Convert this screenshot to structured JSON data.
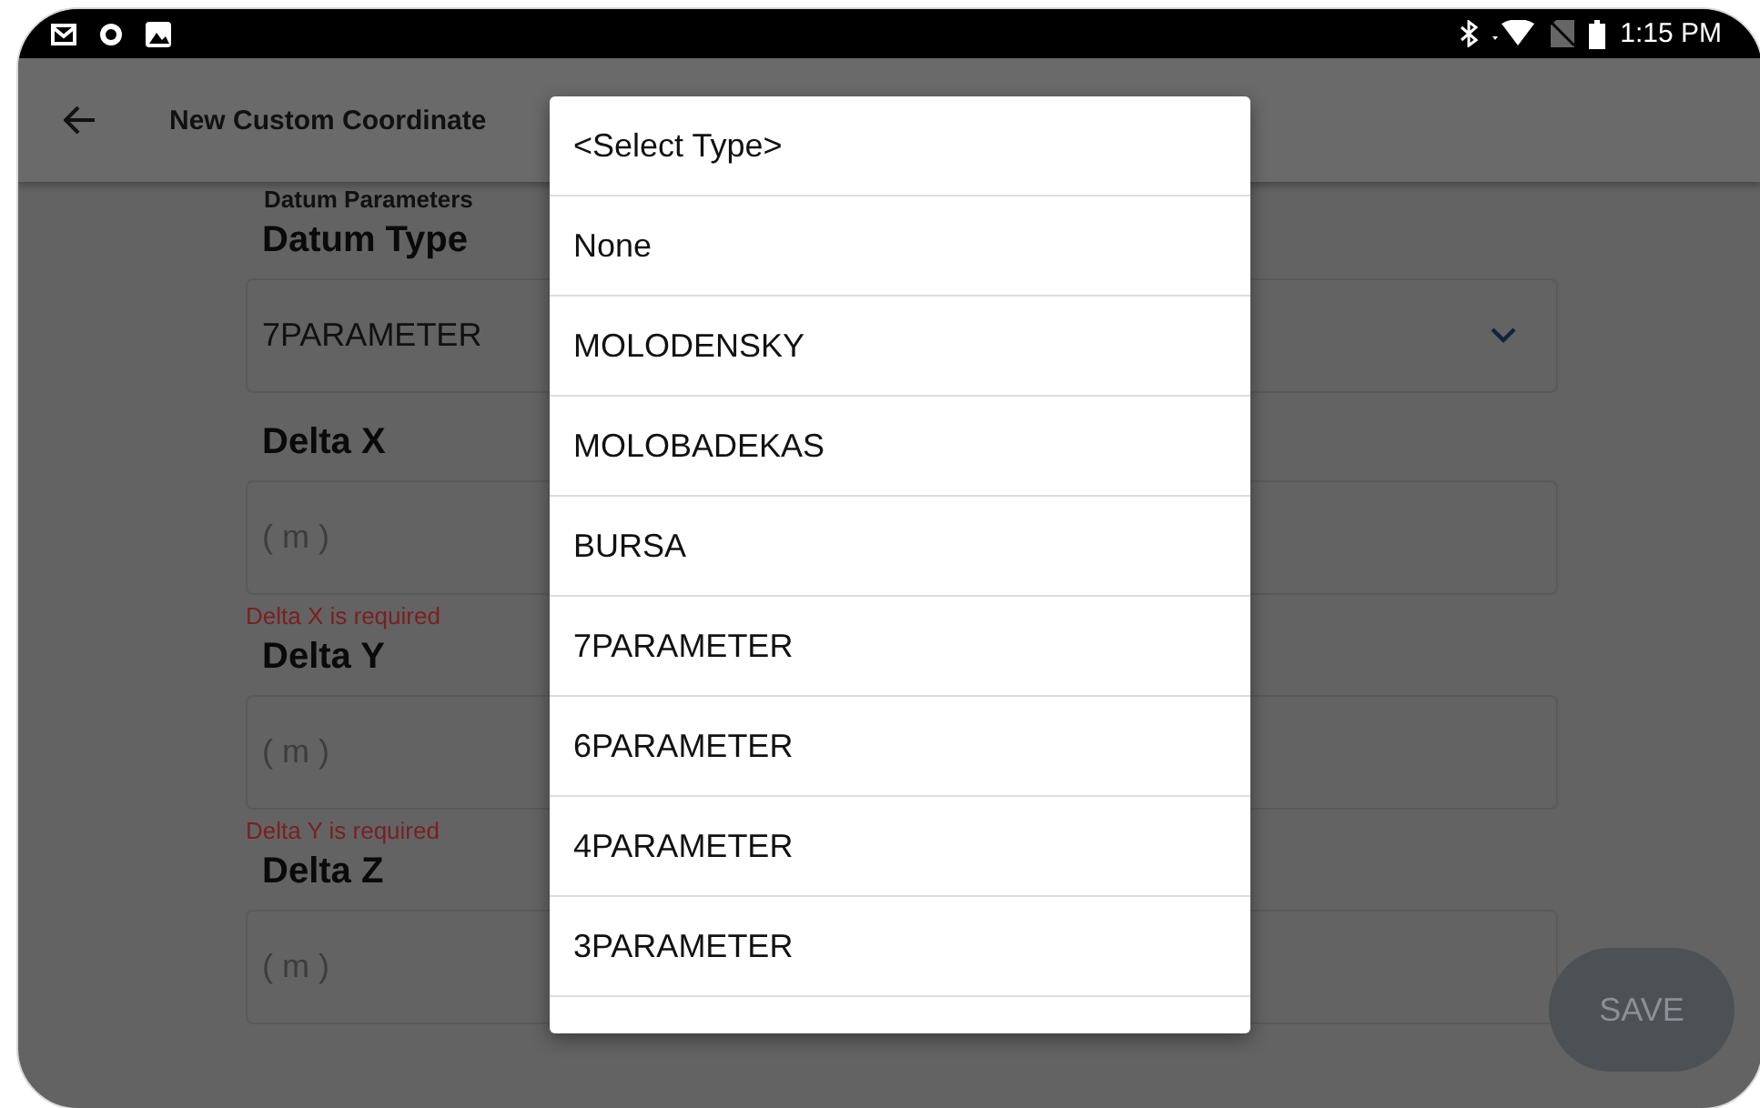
{
  "status_bar": {
    "time": "1:15 PM"
  },
  "app_bar": {
    "title": "New Custom Coordinate"
  },
  "section_title": "Datum Parameters",
  "fields": [
    {
      "kind": "select",
      "label": "Datum Type",
      "value": "7PARAMETER"
    },
    {
      "kind": "input",
      "label": "Delta X",
      "placeholder": "( m )",
      "error": "Delta X is required"
    },
    {
      "kind": "input",
      "label": "Delta Y",
      "placeholder": "( m )",
      "error": "Delta Y is required"
    },
    {
      "kind": "input",
      "label": "Delta Z",
      "placeholder": "( m )"
    }
  ],
  "save_button": {
    "label": "SAVE",
    "disabled": true
  },
  "dropdown": {
    "options": [
      "<Select Type>",
      "None",
      "MOLODENSKY",
      "MOLOBADEKAS",
      "BURSA",
      "7PARAMETER",
      "6PARAMETER",
      "4PARAMETER",
      "3PARAMETER"
    ]
  }
}
